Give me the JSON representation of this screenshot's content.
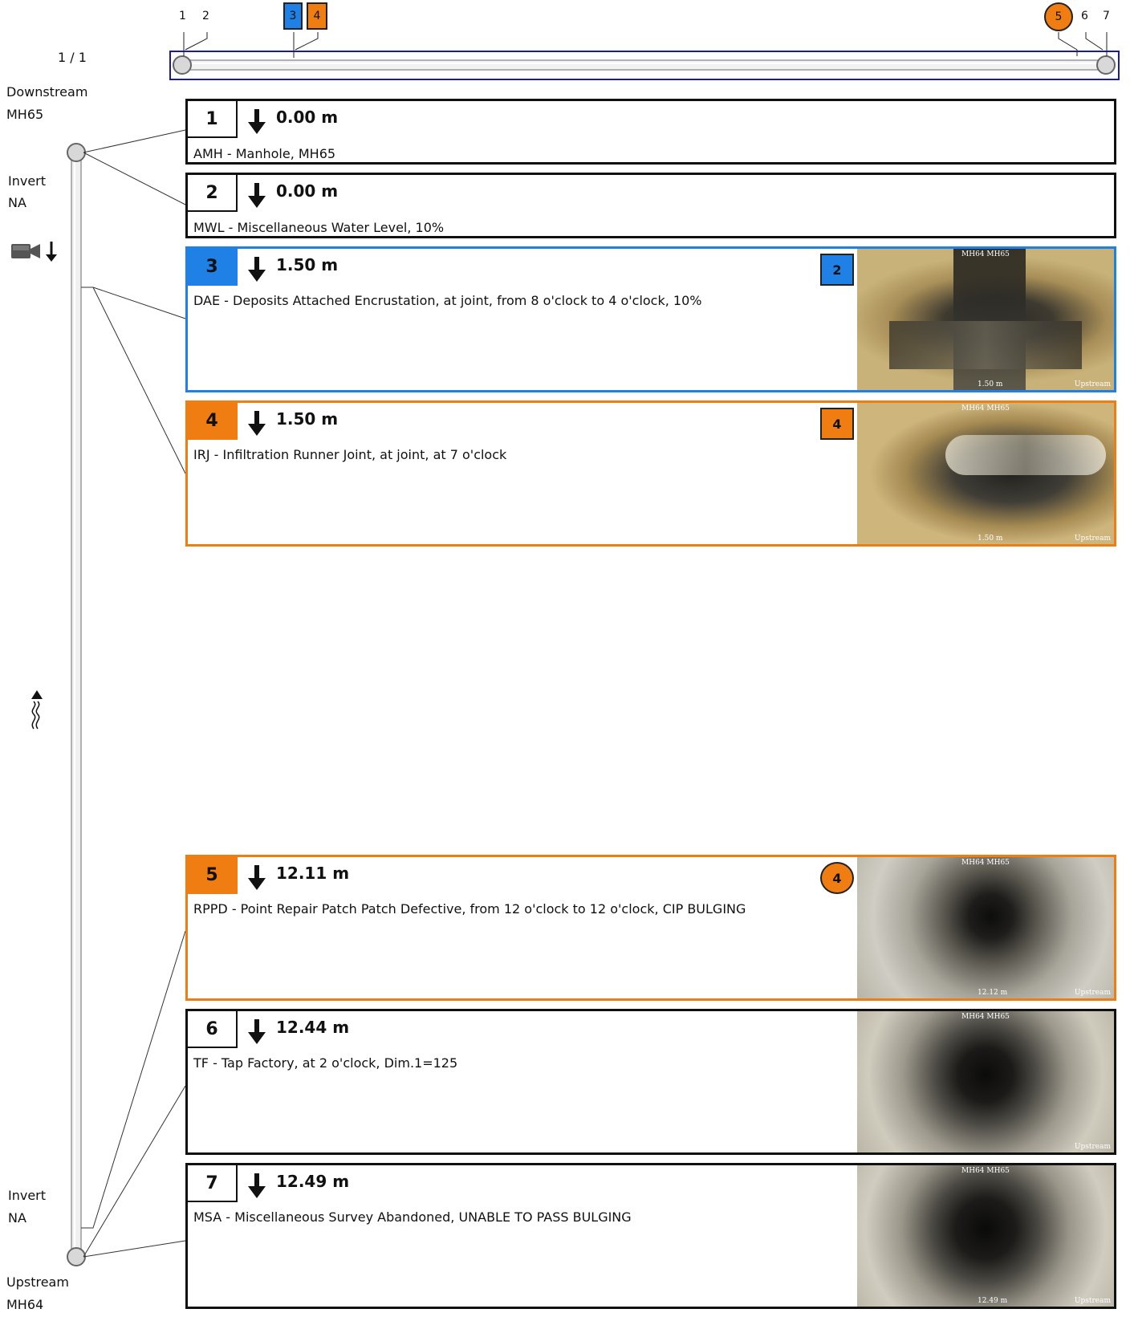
{
  "page_indicator": "1 / 1",
  "left_panel": {
    "downstream_label": "Downstream",
    "downstream_id": "MH65",
    "invert_top_label": "Invert",
    "invert_top_value": "NA",
    "invert_bottom_label": "Invert",
    "invert_bottom_value": "NA",
    "upstream_label": "Upstream",
    "upstream_id": "MH64"
  },
  "overview_ticks": [
    "1",
    "2",
    "3",
    "4",
    "5",
    "6",
    "7"
  ],
  "cards": [
    {
      "num": "1",
      "distance": "0.00 m",
      "description": "AMH - Manhole, MH65"
    },
    {
      "num": "2",
      "distance": "0.00 m",
      "description": "MWL - Miscellaneous Water Level, 10%"
    },
    {
      "num": "3",
      "distance": "1.50 m",
      "description": "DAE - Deposits Attached Encrustation, at joint, from 8 o'clock to 4 o'clock, 10%",
      "badge": "2",
      "photo": {
        "top_text": "MH64 MH65",
        "side_text": "Upstream",
        "dist_text": "1.50 m"
      }
    },
    {
      "num": "4",
      "distance": "1.50 m",
      "description": "IRJ - Infiltration Runner Joint, at joint, at 7 o'clock",
      "badge": "4",
      "photo": {
        "top_text": "MH64 MH65",
        "side_text": "Upstream",
        "dist_text": "1.50 m"
      }
    },
    {
      "num": "5",
      "distance": "12.11 m",
      "description": "RPPD - Point Repair Patch Patch Defective, from 12 o'clock to 12 o'clock, CIP BULGING",
      "badge": "4",
      "photo": {
        "top_text": "MH64 MH65",
        "side_text": "Upstream",
        "dist_text": "12.12 m"
      }
    },
    {
      "num": "6",
      "distance": "12.44 m",
      "description": "TF - Tap Factory, at 2 o'clock, Dim.1=125",
      "photo": {
        "top_text": "MH64 MH65",
        "side_text": "Upstream",
        "dist_text": ""
      }
    },
    {
      "num": "7",
      "distance": "12.49 m",
      "description": "MSA - Miscellaneous Survey Abandoned, UNABLE TO PASS BULGING",
      "photo": {
        "top_text": "MH64 MH65",
        "side_text": "Upstream",
        "dist_text": "12.49 m"
      }
    }
  ],
  "colors": {
    "blue": "#1f80e6",
    "orange": "#f07d12",
    "frame_blue": "#1a1aa8"
  }
}
